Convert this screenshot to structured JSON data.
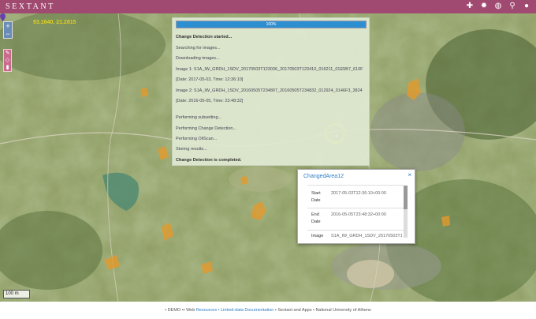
{
  "app": {
    "title": "SEXTANT"
  },
  "toolbar": {
    "icons": [
      "plus-icon",
      "gear-icon",
      "globe-icon",
      "search-icon",
      "user-icon"
    ]
  },
  "map": {
    "coordinates": "93.1640, 21.2815",
    "zoom_in": "+",
    "zoom_out": "−",
    "scale_label": "100 m"
  },
  "progress": {
    "percent_label": "100%",
    "percent": 100,
    "log": [
      "Change Detection started...",
      "Searching for images...",
      "Downloading images...",
      "Image 1: S1A_IW_GRDH_1SDV_20170503T123036_20170503T123410_016211_01E5B7_610F",
      "[Date: 2017-05-03, Time: 12:36:10]",
      "Image 2: S1A_IW_GRDH_1SDV_20160505T234807_20160505T234832_012924_0146F3_3824",
      "[Date: 2016-05-05, Time: 23:48:32]",
      "Performing subsetting...",
      "Performing Change Detection...",
      "Performing OilScan...",
      "Storing results...",
      "Change Detection is completed."
    ]
  },
  "popup": {
    "title": "ChangedArea12",
    "close": "×",
    "rows": [
      {
        "label": "Start Date",
        "value": "2017-05-03T12:36:10+00:00"
      },
      {
        "label": "End Date",
        "value": "2016-05-05T23:48:32+00:00"
      },
      {
        "label": "Image",
        "value": "S1A_IW_GRDH_1SDV_20170503T123036"
      }
    ]
  },
  "footer": {
    "prefix": "• DEMO •• Web",
    "links": "Resources • Linked-data Documentation",
    "suffix": "• Sextant and Apps • National University of Athens"
  },
  "colors": {
    "topbar": "#a04a72",
    "progress_fill": "#2e8fd0",
    "change_area": "#e39a2c",
    "popup_title": "#2a7cc4"
  }
}
